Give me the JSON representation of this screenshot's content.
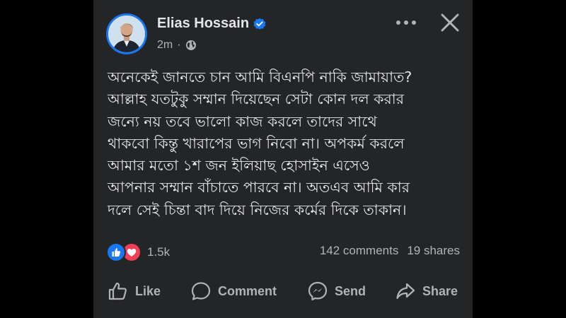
{
  "post": {
    "author_name": "Elias Hossain",
    "time": "2m",
    "separator": "·",
    "text_lines": [
      "অনেকেই জানতে চান আমি বিএনপি নাকি জামায়াত?",
      "আল্লাহ যতটুকু সম্মান দিয়েছেন সেটা কোন দল করার",
      "জন্যে নয় তবে ভালো কাজ করলে তাদের সাথে",
      "থাকবো কিন্তু খারাপের ভাগ নিবো না। অপকর্ম করলে",
      "আমার মতো ১শ জন ইলিয়াছ হোসাইন এসেও",
      "আপনার সম্মান বাঁচাতে পারবে না।  অতএব আমি কার",
      "দলে সেই চিন্তা বাদ দিয়ে নিজের কর্মের দিকে তাকান।"
    ]
  },
  "engagement": {
    "reactions_count": "1.5k",
    "comments": "142 comments",
    "shares": "19 shares"
  },
  "actions": {
    "like": "Like",
    "comment": "Comment",
    "send": "Send",
    "share": "Share"
  },
  "icons": {
    "verified": "verified-badge-icon",
    "audience": "globe-icon",
    "more": "more-icon",
    "close": "close-icon",
    "reaction_like": "like-reaction-icon",
    "reaction_love": "love-reaction-icon",
    "like": "thumbs-up-icon",
    "comment": "comment-bubble-icon",
    "send": "messenger-icon",
    "share": "share-arrow-icon"
  },
  "colors": {
    "page_background": "#000000",
    "card_background": "#242526",
    "primary_text": "#e4e6eb",
    "secondary_text": "#b0b3b8",
    "accent_blue": "#1877f2",
    "love_red": "#f33e58"
  }
}
